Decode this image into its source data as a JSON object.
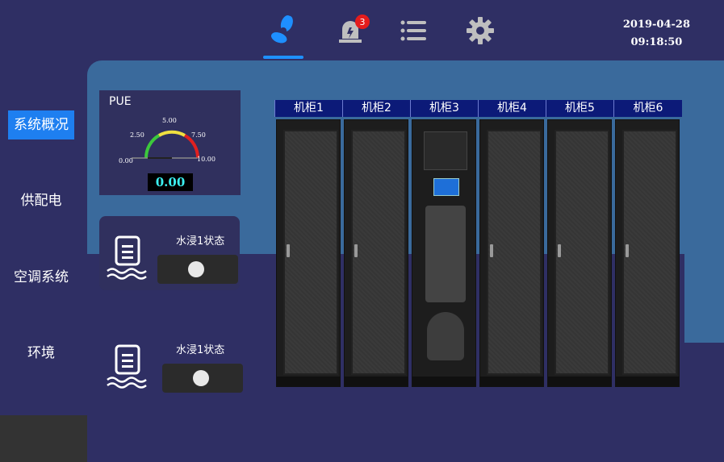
{
  "topbar": {
    "icons": [
      "fan-icon",
      "alarm-icon",
      "list-icon",
      "gear-icon"
    ],
    "alarm_count": "3",
    "date": "2019-04-28",
    "time": "09:18:50"
  },
  "sidebar": {
    "items": [
      {
        "label": "系统概况",
        "active": true
      },
      {
        "label": "供配电",
        "active": false
      },
      {
        "label": "空调系统",
        "active": false
      },
      {
        "label": "环境",
        "active": false
      }
    ]
  },
  "pue": {
    "title": "PUE",
    "gauge_ticks": [
      "0.00",
      "2.50",
      "5.00",
      "7.50",
      "10.00"
    ],
    "value": "0.00",
    "colors": {
      "low": "#3cc83c",
      "mid": "#f0e040",
      "high": "#e02020"
    }
  },
  "water_leak": [
    {
      "label": "水浸1状态",
      "state": "off"
    },
    {
      "label": "水浸1状态",
      "state": "off"
    }
  ],
  "cabinets": [
    {
      "label": "机柜1"
    },
    {
      "label": "机柜2"
    },
    {
      "label": "机柜3"
    },
    {
      "label": "机柜4"
    },
    {
      "label": "机柜5"
    },
    {
      "label": "机柜6"
    }
  ],
  "colors": {
    "background": "#2f2f64",
    "accent": "#1e7ff0",
    "header_blue": "#0c1a78",
    "band": "#3a6a9c"
  }
}
